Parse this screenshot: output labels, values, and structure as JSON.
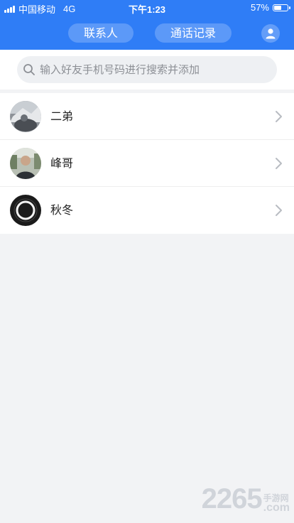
{
  "status_bar": {
    "carrier": "中国移动",
    "network": "4G",
    "time": "下午1:23",
    "battery": "57%",
    "battery_level": 0.57
  },
  "header": {
    "tabs": [
      {
        "label": "联系人",
        "active": true
      },
      {
        "label": "通话记录",
        "active": false
      }
    ],
    "profile_icon": "user-icon"
  },
  "search": {
    "placeholder": "输入好友手机号码进行搜索并添加",
    "value": ""
  },
  "contacts": [
    {
      "name": "二弟",
      "avatar": "photo-avatar"
    },
    {
      "name": "峰哥",
      "avatar": "photo-avatar"
    },
    {
      "name": "秋冬",
      "avatar": "ring-avatar"
    }
  ],
  "watermark": {
    "number": "2265",
    "top": "手游网",
    "bottom": ".com"
  },
  "colors": {
    "header": "#2f7df6",
    "background": "#f2f3f5"
  }
}
